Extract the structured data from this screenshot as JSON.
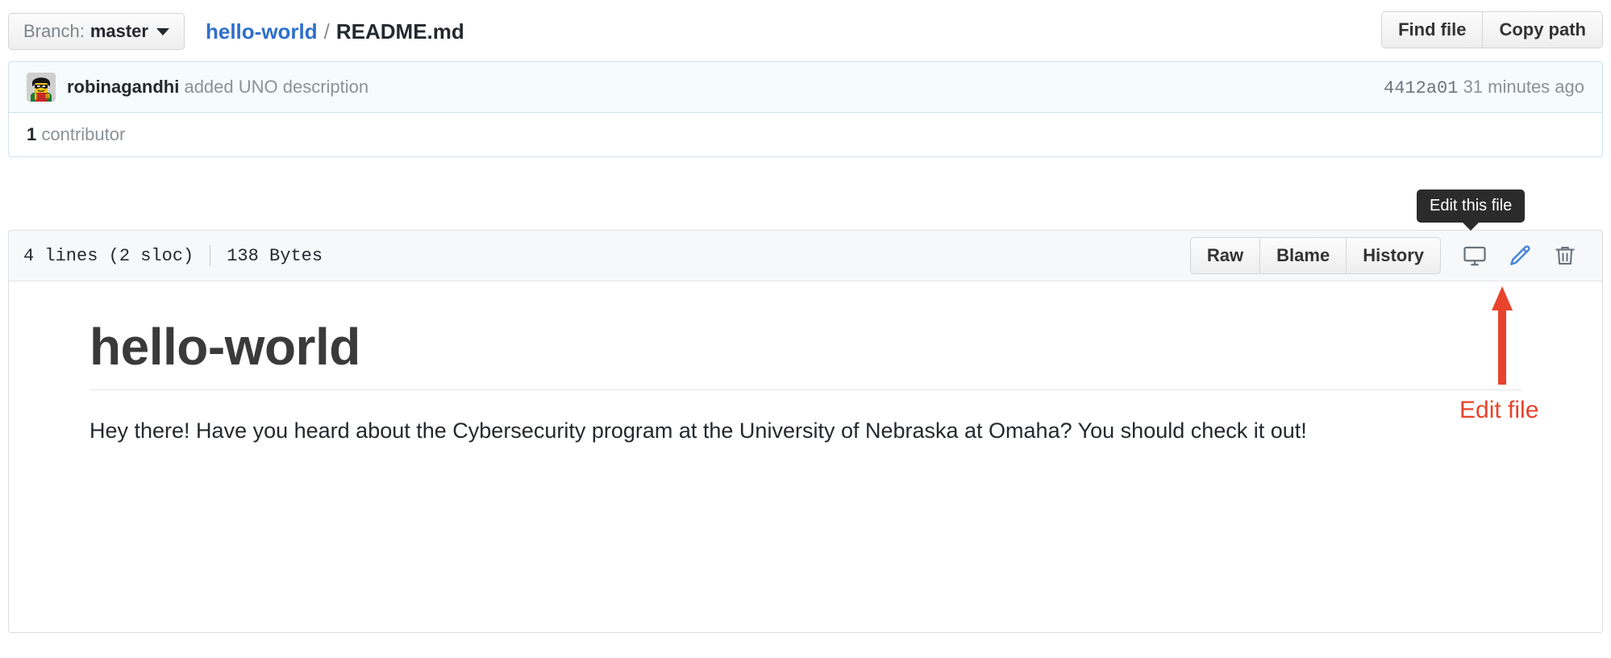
{
  "header": {
    "branch_label": "Branch:",
    "branch_name": "master",
    "branch_caret_icon": "chevron-down-icon",
    "repo_name": "hello-world",
    "path_separator": "/",
    "file_name": "README.md",
    "find_file_label": "Find file",
    "copy_path_label": "Copy path"
  },
  "commit": {
    "avatar_icon": "user-avatar-lego-robin",
    "author": "robinagandhi",
    "message": "added UNO description",
    "sha": "4412a01",
    "time_ago": "31 minutes ago",
    "contributor_count": "1",
    "contributor_label": "contributor"
  },
  "file_meta": {
    "lines": "4 lines (2 sloc)",
    "size": "138 Bytes",
    "raw_label": "Raw",
    "blame_label": "Blame",
    "history_label": "History",
    "desktop_icon": "desktop-download-icon",
    "edit_icon": "pencil-edit-icon",
    "delete_icon": "trash-delete-icon",
    "edit_icon_color": "#4a86d6"
  },
  "tooltip": {
    "text": "Edit this file",
    "background": "#2b2b2b"
  },
  "readme": {
    "heading": "hello-world",
    "paragraph": "Hey there! Have you heard about the Cybersecurity program at the University of Nebraska at Omaha? You should check it out!"
  },
  "annotation": {
    "arrow_icon": "up-arrow-annotation",
    "label": "Edit file",
    "color": "#e8432c"
  }
}
